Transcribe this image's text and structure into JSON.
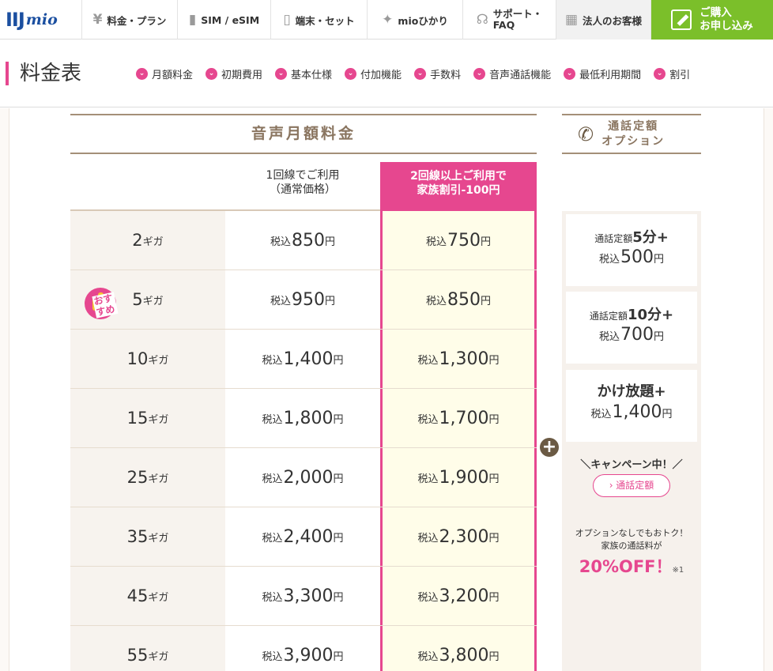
{
  "nav": {
    "logo_main": "IIJ",
    "logo_sub": "mio",
    "items": [
      {
        "icon": "¥",
        "label": "料金・プラン"
      },
      {
        "icon": "▮",
        "label": "SIM / eSIM"
      },
      {
        "icon": "▯",
        "label": "端末・セット"
      },
      {
        "icon": "✦",
        "label": "mioひかり"
      },
      {
        "icon": "☊",
        "label1": "サポート・",
        "label2": "FAQ"
      },
      {
        "icon": "▦",
        "label": "法人のお客様"
      }
    ],
    "buy_line1": "ご購入",
    "buy_line2": "お申し込み"
  },
  "subheader": {
    "title": "料金表",
    "links": [
      "月額料金",
      "初期費用",
      "基本仕様",
      "付加機能",
      "手数料",
      "音声通話機能",
      "最低利用期間",
      "割引"
    ]
  },
  "table": {
    "title": "音声月額料金",
    "col_normal_1": "1回線でご利用",
    "col_normal_2": "（通常価格）",
    "col_family_1": "2回線以上ご利用で",
    "col_family_2": "家族割引-100円",
    "tax_prefix": "税込",
    "yen_suffix": "円",
    "unit": "ギガ",
    "recommend_badge": "おすすめ",
    "rows": [
      {
        "plan": "2",
        "normal": "850",
        "family": "750"
      },
      {
        "plan": "5",
        "normal": "950",
        "family": "850"
      },
      {
        "plan": "10",
        "normal": "1,400",
        "family": "1,300"
      },
      {
        "plan": "15",
        "normal": "1,800",
        "family": "1,700"
      },
      {
        "plan": "25",
        "normal": "2,000",
        "family": "1,900"
      },
      {
        "plan": "35",
        "normal": "2,400",
        "family": "2,300"
      },
      {
        "plan": "45",
        "normal": "3,300",
        "family": "3,200"
      },
      {
        "plan": "55",
        "normal": "3,900",
        "family": "3,800"
      }
    ]
  },
  "options": {
    "title_1": "通話定額",
    "title_2": "オプション",
    "plus": "+",
    "cards": [
      {
        "small": "通話定額",
        "strong": "5分+",
        "price": "500"
      },
      {
        "small": "通話定額",
        "strong": "10分+",
        "price": "700"
      },
      {
        "big": "かけ放題+",
        "price": "1,400"
      }
    ],
    "campaign": "＼キャンペーン中！／",
    "campaign_btn": "› 通話定額",
    "promo_1": "オプションなしでもおトク！",
    "promo_2": "家族の通話料が",
    "promo_big": "20%OFF！",
    "promo_note": "※1"
  },
  "colors": {
    "accent": "#e6478f",
    "brand_blue": "#1b4fa0",
    "buy_green": "#7bbf2a",
    "gold": "#8a7560",
    "family_bg": "#fffde9"
  }
}
